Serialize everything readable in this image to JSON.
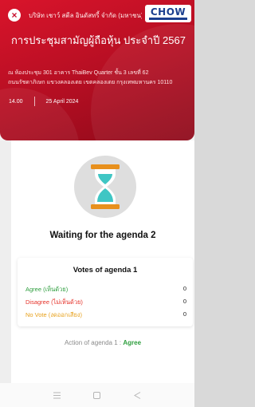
{
  "header": {
    "company_name": "บริษัท เชาว์ สตีล อินดัสทรี้ จำกัด (มหาชน)",
    "logo_text": "CHOW",
    "title": "การประชุมสามัญผู้ถือหุ้น ประจำปี 2567",
    "venue_line1": "ณ ห้องประชุม 301 อาคาร ThaiBev Quarter ชั้น 3 เลขที่ 62",
    "venue_line2": "ถนนรัชดาภิเษก แขวงคลองเตย เขตคลองเตย กรุงเทพมหานคร 10110",
    "time": "14.00",
    "date": "25 April 2024"
  },
  "status": {
    "waiting_text": "Waiting for the agenda 2"
  },
  "votes": {
    "title": "Votes of agenda 1",
    "rows": [
      {
        "label": "Agree (เห็นด้วย)",
        "value": "0"
      },
      {
        "label": "Disagree (ไม่เห็นด้วย)",
        "value": "0"
      },
      {
        "label": "No Vote (งดออกเสียง)",
        "value": "0"
      }
    ]
  },
  "action": {
    "prefix": "Action of agenda 1 :",
    "value": "Agree"
  },
  "colors": {
    "header_red": "#c8102e",
    "agree": "#2e9e3e",
    "disagree": "#e5332a",
    "no_vote": "#e7a01a",
    "logo_blue": "#1b3f8f"
  },
  "icons": {
    "close": "close-icon",
    "hourglass": "hourglass-icon",
    "nav_menu": "menu-icon",
    "nav_home": "home-icon",
    "nav_back": "back-icon"
  }
}
